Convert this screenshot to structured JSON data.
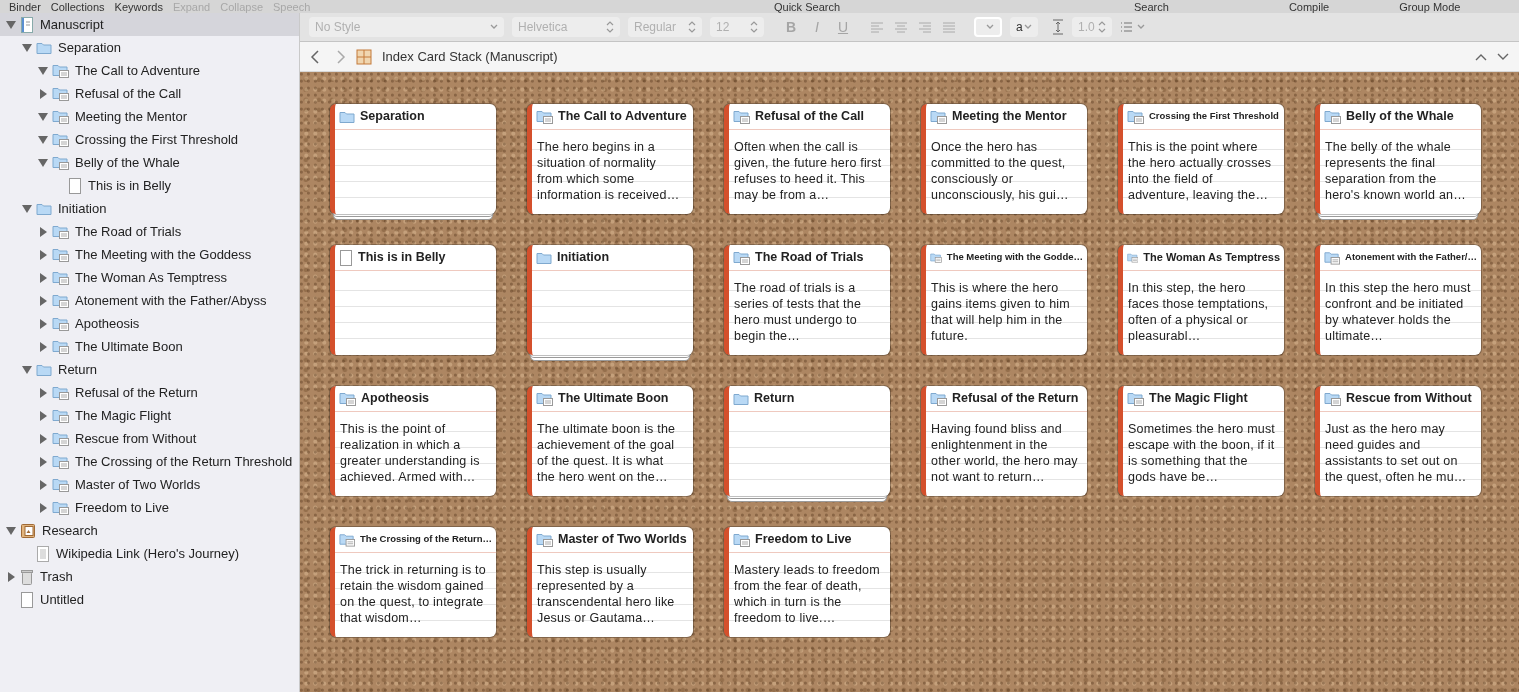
{
  "toolbar": {
    "left": [
      {
        "label": "Binder",
        "disabled": false
      },
      {
        "label": "Collections",
        "disabled": false
      },
      {
        "label": "Keywords",
        "disabled": false
      },
      {
        "label": "Expand",
        "disabled": true
      },
      {
        "label": "Collapse",
        "disabled": true
      },
      {
        "label": "Speech",
        "disabled": true
      }
    ],
    "right": [
      {
        "label": "Quick Search",
        "disabled": false
      },
      {
        "label": "Search",
        "disabled": false
      },
      {
        "label": "Compile",
        "disabled": false
      },
      {
        "label": "Group Mode",
        "disabled": false
      }
    ]
  },
  "binder": {
    "items": [
      {
        "label": "Manuscript",
        "kind": "draft",
        "expanded": true,
        "selected": true,
        "children": [
          {
            "label": "Separation",
            "kind": "folder",
            "expanded": true,
            "selected": false,
            "children": [
              {
                "label": "The Call to Adventure",
                "kind": "folder-doc",
                "expanded": true,
                "selected": false
              },
              {
                "label": "Refusal of the Call",
                "kind": "folder-doc",
                "expanded": false,
                "selected": false
              },
              {
                "label": "Meeting the Mentor",
                "kind": "folder-doc",
                "expanded": true,
                "selected": false
              },
              {
                "label": "Crossing the First Threshold",
                "kind": "folder-doc",
                "expanded": true,
                "selected": false
              },
              {
                "label": "Belly of the Whale",
                "kind": "folder-doc",
                "expanded": true,
                "selected": false,
                "children": [
                  {
                    "label": "This is in Belly",
                    "kind": "doc",
                    "selected": false
                  }
                ]
              }
            ]
          },
          {
            "label": "Initiation",
            "kind": "folder",
            "expanded": true,
            "selected": false,
            "children": [
              {
                "label": "The Road of Trials",
                "kind": "folder-doc",
                "expanded": false,
                "selected": false
              },
              {
                "label": "The Meeting with the Goddess",
                "kind": "folder-doc",
                "expanded": false,
                "selected": false
              },
              {
                "label": "The Woman As Temptress",
                "kind": "folder-doc",
                "expanded": false,
                "selected": false
              },
              {
                "label": "Atonement with the Father/Abyss",
                "kind": "folder-doc",
                "expanded": false,
                "selected": false
              },
              {
                "label": "Apotheosis",
                "kind": "folder-doc",
                "expanded": false,
                "selected": false
              },
              {
                "label": "The Ultimate Boon",
                "kind": "folder-doc",
                "expanded": false,
                "selected": false
              }
            ]
          },
          {
            "label": "Return",
            "kind": "folder",
            "expanded": true,
            "selected": false,
            "children": [
              {
                "label": "Refusal of the Return",
                "kind": "folder-doc",
                "expanded": false,
                "selected": false
              },
              {
                "label": "The Magic Flight",
                "kind": "folder-doc",
                "expanded": false,
                "selected": false
              },
              {
                "label": "Rescue from Without",
                "kind": "folder-doc",
                "expanded": false,
                "selected": false
              },
              {
                "label": "The Crossing of the Return Threshold",
                "kind": "folder-doc",
                "expanded": false,
                "selected": false
              },
              {
                "label": "Master of Two Worlds",
                "kind": "folder-doc",
                "expanded": false,
                "selected": false
              },
              {
                "label": "Freedom to Live",
                "kind": "folder-doc",
                "expanded": false,
                "selected": false
              }
            ]
          }
        ]
      },
      {
        "label": "Research",
        "kind": "research",
        "expanded": true,
        "selected": false,
        "children": [
          {
            "label": "Wikipedia Link (Hero's Journey)",
            "kind": "web",
            "selected": false
          }
        ]
      },
      {
        "label": "Trash",
        "kind": "trash",
        "expanded": false,
        "selected": false
      },
      {
        "label": "Untitled",
        "kind": "doc",
        "selected": false
      }
    ]
  },
  "format_bar": {
    "disabled": true,
    "style": "No Style",
    "font": "Helvetica",
    "weight": "Regular",
    "size": "12",
    "bold": "B",
    "italic": "I",
    "underline": "U",
    "highlight": "a",
    "line_spacing": "1.0"
  },
  "header": {
    "title": "Index Card Stack (Manuscript)"
  },
  "cards": [
    {
      "title": "Separation",
      "kind": "folder",
      "stacked": true
    },
    {
      "title": "The Call to Adventure",
      "kind": "folder-doc",
      "stacked": false,
      "synopsis": "The hero begins in a situation of normality from which some information is received…"
    },
    {
      "title": "Refusal of the Call",
      "kind": "folder-doc",
      "stacked": false,
      "synopsis": "Often when the call is given, the future hero first refuses to heed it. This may be from a…"
    },
    {
      "title": "Meeting the Mentor",
      "kind": "folder-doc",
      "stacked": false,
      "synopsis": "Once the hero has committed to the quest, consciously or unconsciously, his gui…"
    },
    {
      "title": "Crossing the First Threshold",
      "kind": "folder-doc",
      "stacked": false,
      "synopsis": "This is the point where the hero actually crosses into the field of adventure, leaving the…"
    },
    {
      "title": "Belly of the Whale",
      "kind": "folder-doc",
      "stacked": true,
      "synopsis": "The belly of the whale represents the final separation from the hero's known world an…"
    },
    {
      "title": "This is in Belly",
      "kind": "doc",
      "stacked": false
    },
    {
      "title": "Initiation",
      "kind": "folder",
      "stacked": true
    },
    {
      "title": "The Road of Trials",
      "kind": "folder-doc",
      "stacked": false,
      "synopsis": "The road of trials is a series of tests that the hero must undergo to begin the…"
    },
    {
      "title": "The Meeting with the Godde…",
      "kind": "folder-doc",
      "stacked": false,
      "synopsis": "This is where the hero gains items given to him that will help him in the future."
    },
    {
      "title": "The Woman As Temptress",
      "kind": "folder-doc",
      "stacked": false,
      "synopsis": "In this step, the hero faces those temptations, often of a physical or pleasurabl…"
    },
    {
      "title": "Atonement with the Father/…",
      "kind": "folder-doc",
      "stacked": false,
      "synopsis": "In this step the hero must confront and be initiated by whatever holds the ultimate…"
    },
    {
      "title": "Apotheosis",
      "kind": "folder-doc",
      "stacked": false,
      "synopsis": "This is the point of realization in which a greater understanding is achieved. Armed with…"
    },
    {
      "title": "The Ultimate Boon",
      "kind": "folder-doc",
      "stacked": false,
      "synopsis": "The ultimate boon is the achievement of the goal of the quest. It is what the hero went on the…"
    },
    {
      "title": "Return",
      "kind": "folder",
      "stacked": true
    },
    {
      "title": "Refusal of the Return",
      "kind": "folder-doc",
      "stacked": false,
      "synopsis": "Having found bliss and enlightenment in the other world, the hero may not want to return…"
    },
    {
      "title": "The Magic Flight",
      "kind": "folder-doc",
      "stacked": false,
      "synopsis": "Sometimes the hero must escape with the boon, if it is something that the gods have be…"
    },
    {
      "title": "Rescue from Without",
      "kind": "folder-doc",
      "stacked": false,
      "synopsis": "Just as the hero may need guides and assistants to set out on the quest, often he mu…"
    },
    {
      "title": "The Crossing of the Return…",
      "kind": "folder-doc",
      "stacked": false,
      "synopsis": "The trick in returning is to retain the wisdom gained on the quest, to integrate that wisdom…"
    },
    {
      "title": "Master of Two Worlds",
      "kind": "folder-doc",
      "stacked": false,
      "synopsis": "This step is usually represented by a transcendental hero like Jesus or Gautama…"
    },
    {
      "title": "Freedom to Live",
      "kind": "folder-doc",
      "stacked": false,
      "synopsis": "Mastery leads to freedom from the fear of death, which in turn is the freedom to live.…"
    }
  ]
}
